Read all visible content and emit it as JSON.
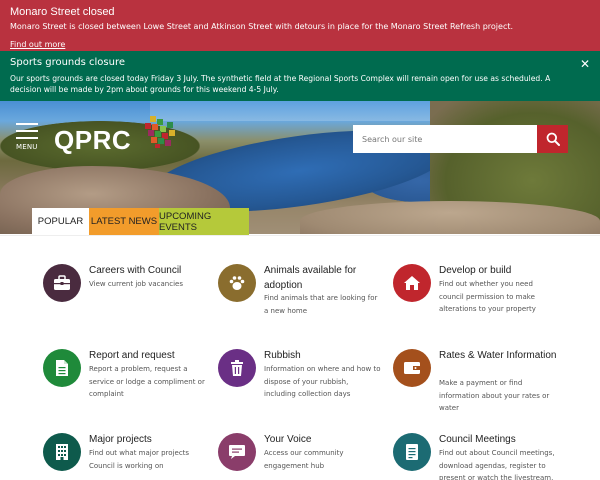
{
  "alerts": {
    "closure": {
      "title": "Monaro Street closed",
      "text": "Monaro Street is closed between Lowe Street and Atkinson Street with detours in place for the Monaro Street Refresh project.",
      "link": "Find out more",
      "color": "#b9323f"
    },
    "sports": {
      "title": "Sports grounds closure",
      "text": "Our sports grounds are closed today Friday 3 July. The synthetic field at the Regional Sports Complex will remain open for use as scheduled. A decision will be made by 2pm about grounds for this weekend 4-5 July.",
      "close_glyph": "✕",
      "color": "#006b4f"
    }
  },
  "header": {
    "menu_label": "MENU",
    "logo_text": "QPRC",
    "search_placeholder": "Search our site",
    "search_icon": "search-icon"
  },
  "tabs": [
    {
      "label": "POPULAR",
      "color": "#ffffff"
    },
    {
      "label": "LATEST NEWS",
      "color": "#f29c2b"
    },
    {
      "label": "UPCOMING EVENTS",
      "color": "#b5c93a"
    }
  ],
  "cards": [
    {
      "title": "Careers with Council",
      "desc": "View current job vacancies",
      "icon": "briefcase-icon",
      "color": "#4a2b3f"
    },
    {
      "title": "Animals available for adoption",
      "desc": "Find animals that are looking for a new home",
      "icon": "paw-icon",
      "color": "#8a6d2e"
    },
    {
      "title": "Develop or build",
      "desc": "Find out whether you need council permission to make alterations to your property",
      "icon": "house-icon",
      "color": "#c0262d"
    },
    {
      "title": "Report and request",
      "desc": "Report a problem, request a service or lodge a compliment or complaint",
      "icon": "document-icon",
      "color": "#1f8a3a"
    },
    {
      "title": "Rubbish",
      "desc": "Information on where and how to dispose of your rubbish, including collection days",
      "icon": "trash-icon",
      "color": "#6a2f85"
    },
    {
      "title": "Rates & Water Information",
      "desc": "Make a payment or find information about your rates or water",
      "icon": "wallet-icon",
      "color": "#a4501c"
    },
    {
      "title": "Major projects",
      "desc": "Find out what major projects Council is working on",
      "icon": "building-icon",
      "color": "#0e5a4c"
    },
    {
      "title": "Your Voice",
      "desc": "Access our community engagement hub",
      "icon": "speech-bubble-icon",
      "color": "#8a3d6a"
    },
    {
      "title": "Council Meetings",
      "desc": "Find out about Council meetings, download agendas, register to present or watch the livestream.",
      "icon": "agenda-icon",
      "color": "#1c6b73"
    }
  ]
}
